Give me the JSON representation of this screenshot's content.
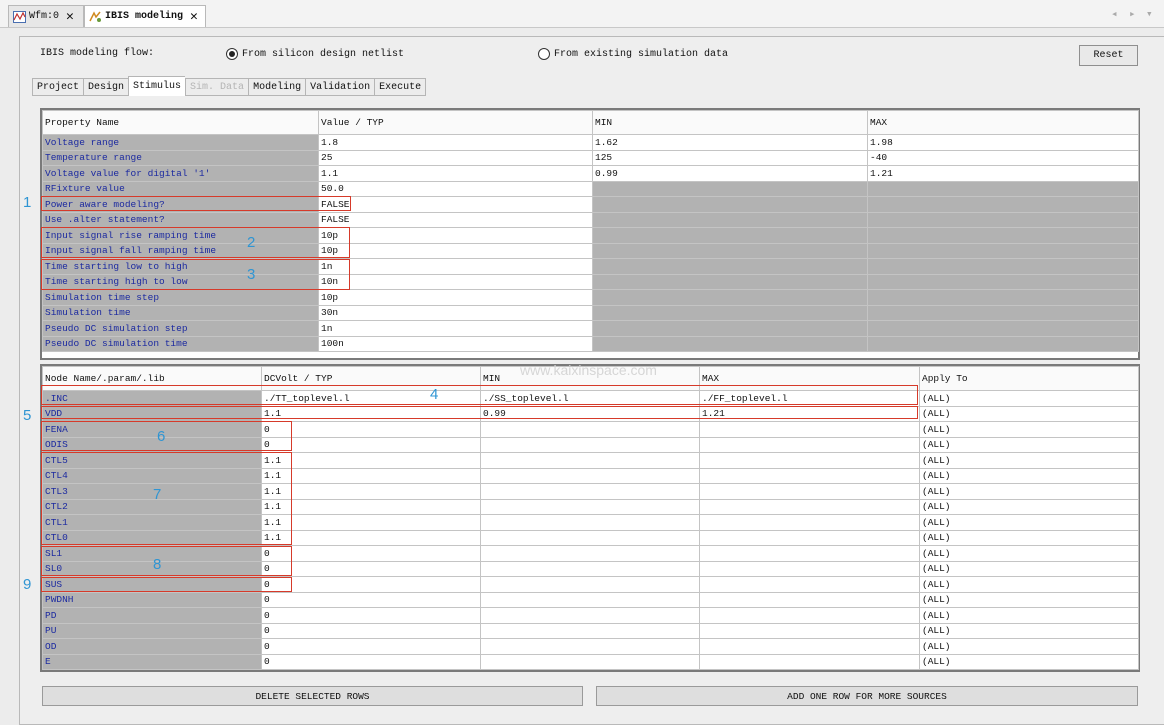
{
  "editor_tabs": [
    {
      "label": "Wfm:0",
      "icon": "waveform-icon"
    },
    {
      "label": "IBIS modeling",
      "icon": "ibis-modeling-icon"
    }
  ],
  "panel": {
    "flow_label": "IBIS modeling flow:",
    "radio_options": [
      {
        "label": "From silicon design netlist",
        "selected": true
      },
      {
        "label": "From existing simulation data",
        "selected": false
      }
    ],
    "reset_label": "Reset"
  },
  "sub_tabs": [
    {
      "label": "Project",
      "state": "normal"
    },
    {
      "label": "Design",
      "state": "normal"
    },
    {
      "label": "Stimulus",
      "state": "active"
    },
    {
      "label": "Sim. Data",
      "state": "disabled"
    },
    {
      "label": "Modeling",
      "state": "normal"
    },
    {
      "label": "Validation",
      "state": "normal"
    },
    {
      "label": "Execute",
      "state": "normal"
    }
  ],
  "property_table": {
    "headers": [
      "Property Name",
      "Value / TYP",
      "MIN",
      "MAX"
    ],
    "rows": [
      {
        "name": "Voltage range",
        "value": "1.8",
        "min": "1.62",
        "max": "1.98"
      },
      {
        "name": "Temperature range",
        "value": "25",
        "min": "125",
        "max": "-40"
      },
      {
        "name": "Voltage value for digital '1'",
        "value": "1.1",
        "min": "0.99",
        "max": "1.21"
      },
      {
        "name": "RFixture value",
        "value": "50.0",
        "min": null,
        "max": null
      },
      {
        "name": "Power aware modeling?",
        "value": "FALSE",
        "min": null,
        "max": null
      },
      {
        "name": "Use .alter statement?",
        "value": "FALSE",
        "min": null,
        "max": null
      },
      {
        "name": "Input signal rise ramping time",
        "value": "10p",
        "min": null,
        "max": null
      },
      {
        "name": "Input signal fall ramping time",
        "value": "10p",
        "min": null,
        "max": null
      },
      {
        "name": "Time starting low to high",
        "value": "1n",
        "min": null,
        "max": null
      },
      {
        "name": "Time starting high to low",
        "value": "10n",
        "min": null,
        "max": null
      },
      {
        "name": "Simulation time step",
        "value": "10p",
        "min": null,
        "max": null
      },
      {
        "name": "Simulation time",
        "value": "30n",
        "min": null,
        "max": null
      },
      {
        "name": "Pseudo DC simulation step",
        "value": "1n",
        "min": null,
        "max": null
      },
      {
        "name": "Pseudo DC simulation time",
        "value": "100n",
        "min": null,
        "max": null
      }
    ]
  },
  "source_table": {
    "headers": [
      "Node Name/.param/.lib",
      "DCVolt / TYP",
      "MIN",
      "MAX",
      "Apply To"
    ],
    "rows": [
      {
        "name": ".INC",
        "typ": "./TT_toplevel.l",
        "min": "./SS_toplevel.l",
        "max": "./FF_toplevel.l",
        "apply": "(ALL)"
      },
      {
        "name": "VDD",
        "typ": "1.1",
        "min": "0.99",
        "max": "1.21",
        "apply": "(ALL)"
      },
      {
        "name": "FENA",
        "typ": "0",
        "min": "",
        "max": "",
        "apply": "(ALL)"
      },
      {
        "name": "ODIS",
        "typ": "0",
        "min": "",
        "max": "",
        "apply": "(ALL)"
      },
      {
        "name": "CTL5",
        "typ": "1.1",
        "min": "",
        "max": "",
        "apply": "(ALL)"
      },
      {
        "name": "CTL4",
        "typ": "1.1",
        "min": "",
        "max": "",
        "apply": "(ALL)"
      },
      {
        "name": "CTL3",
        "typ": "1.1",
        "min": "",
        "max": "",
        "apply": "(ALL)"
      },
      {
        "name": "CTL2",
        "typ": "1.1",
        "min": "",
        "max": "",
        "apply": "(ALL)"
      },
      {
        "name": "CTL1",
        "typ": "1.1",
        "min": "",
        "max": "",
        "apply": "(ALL)"
      },
      {
        "name": "CTL0",
        "typ": "1.1",
        "min": "",
        "max": "",
        "apply": "(ALL)"
      },
      {
        "name": "SL1",
        "typ": "0",
        "min": "",
        "max": "",
        "apply": "(ALL)"
      },
      {
        "name": "SL0",
        "typ": "0",
        "min": "",
        "max": "",
        "apply": "(ALL)"
      },
      {
        "name": "SUS",
        "typ": "0",
        "min": "",
        "max": "",
        "apply": "(ALL)"
      },
      {
        "name": "PWDNH",
        "typ": "0",
        "min": "",
        "max": "",
        "apply": "(ALL)"
      },
      {
        "name": "PD",
        "typ": "0",
        "min": "",
        "max": "",
        "apply": "(ALL)"
      },
      {
        "name": "PU",
        "typ": "0",
        "min": "",
        "max": "",
        "apply": "(ALL)"
      },
      {
        "name": "OD",
        "typ": "0",
        "min": "",
        "max": "",
        "apply": "(ALL)"
      },
      {
        "name": "E",
        "typ": "0",
        "min": "",
        "max": "",
        "apply": "(ALL)"
      }
    ]
  },
  "buttons": {
    "delete_rows": "DELETE SELECTED ROWS",
    "add_row": "ADD ONE ROW FOR MORE SOURCES"
  },
  "annotations": [
    "1",
    "2",
    "3",
    "4",
    "5",
    "6",
    "7",
    "8",
    "9"
  ],
  "watermark": "www.kaixinspace.com",
  "colors": {
    "highlight": "#d63a2a",
    "annotation_number": "#2f95d3",
    "name_cell": "#b2b2b2",
    "name_text": "#1c2aa0"
  }
}
